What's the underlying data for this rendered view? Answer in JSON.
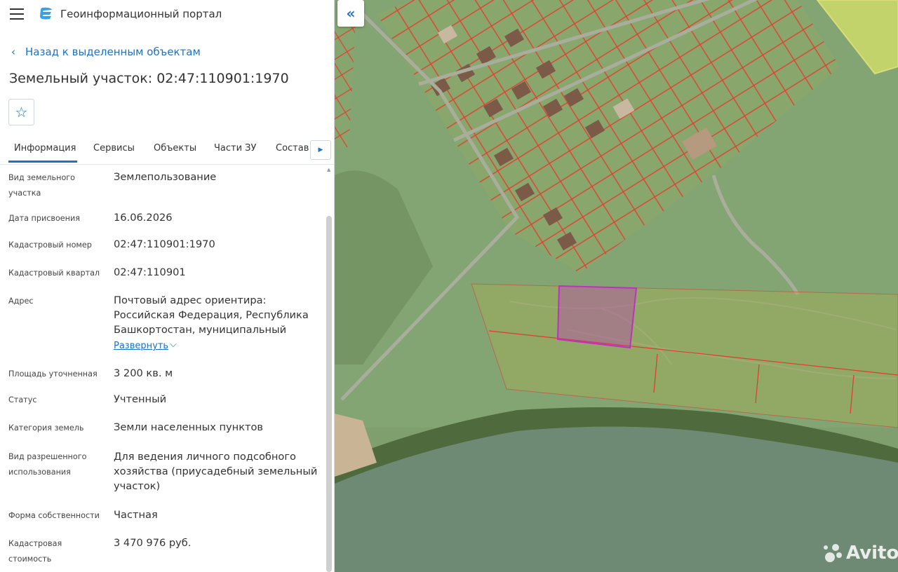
{
  "app": {
    "title": "Геоинформационный портал"
  },
  "nav": {
    "back_label": "Назад к выделенным объектам"
  },
  "object": {
    "title": "Земельный участок: 02:47:110901:1970"
  },
  "tabs": [
    {
      "label": "Информация",
      "active": true
    },
    {
      "label": "Сервисы"
    },
    {
      "label": "Объекты"
    },
    {
      "label": "Части ЗУ"
    },
    {
      "label": "Состав"
    }
  ],
  "attributes": [
    {
      "label": "Вид земельного участка",
      "value": "Землепользование"
    },
    {
      "label": "Дата присвоения",
      "value": "16.06.2026"
    },
    {
      "label": "Кадастровый номер",
      "value": "02:47:110901:1970"
    },
    {
      "label": "Кадастровый квартал",
      "value": "02:47:110901"
    },
    {
      "label": "Адрес",
      "value": "Почтовый адрес ориентира: Российская Федерация, Республика Башкортостан, муниципальный"
    },
    {
      "label": "Площадь уточненная",
      "value": "3 200 кв. м"
    },
    {
      "label": "Статус",
      "value": "Учтенный"
    },
    {
      "label": "Категория земель",
      "value": "Земли населенных пунктов"
    },
    {
      "label": "Вид разрешенного использования",
      "value": "Для ведения личного подсобного хозяйства (приусадебный земельный участок)"
    },
    {
      "label": "Форма собственности",
      "value": "Частная"
    },
    {
      "label": "Кадастровая стоимость",
      "value": "3 470 976 руб."
    }
  ],
  "address_expand_label": "Развернуть",
  "watermark": "Avito",
  "icons": {
    "menu": "hamburger-icon",
    "logo": "portal-logo-icon",
    "back": "chevron-left-icon",
    "favorite": "star-icon",
    "tabs_next": "triangle-right-icon",
    "collapse": "double-chevron-left-icon",
    "expand": "chevron-down-icon"
  },
  "colors": {
    "accent": "#1a73c8",
    "parcel_border": "#e03a2f",
    "selected_parcel": "#c030c0"
  }
}
